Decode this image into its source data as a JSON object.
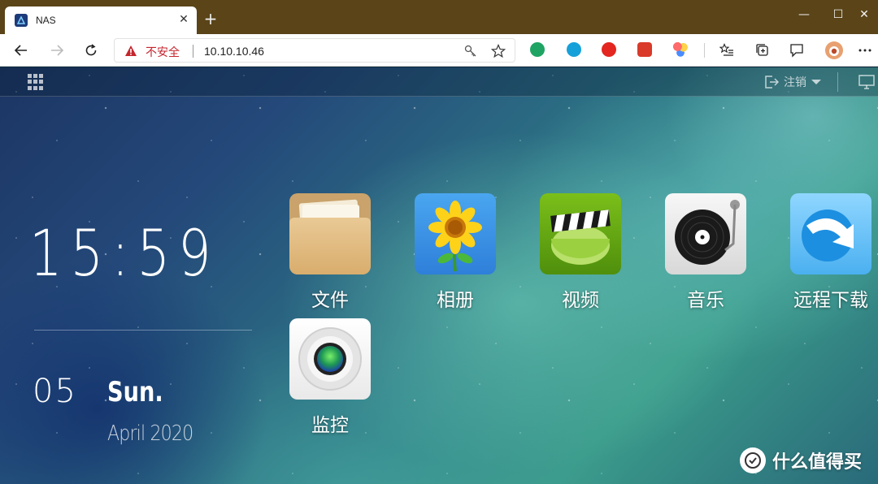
{
  "browser": {
    "tab_title": "NAS",
    "tab_close": "✕",
    "new_tab": "+",
    "insecure_label": "不安全",
    "url": "10.10.10.46",
    "window_controls": {
      "minimize": "—",
      "maximize": "☐",
      "close": "✕"
    }
  },
  "nas": {
    "logout_label": "注销",
    "clock": "15:59",
    "day": "05",
    "weekday": "Sun.",
    "month_year": "April 2020",
    "apps": [
      {
        "label": "文件",
        "icon": "folder-icon"
      },
      {
        "label": "相册",
        "icon": "sunflower-photo-icon"
      },
      {
        "label": "视频",
        "icon": "clapperboard-icon"
      },
      {
        "label": "音乐",
        "icon": "turntable-icon"
      },
      {
        "label": "远程下载",
        "icon": "download-arrow-icon"
      },
      {
        "label": "监控",
        "icon": "camera-lens-icon"
      }
    ]
  },
  "watermark": {
    "text": "什么值得买"
  },
  "colors": {
    "titlebar": "#5a4418",
    "insecure": "#c4262e"
  }
}
